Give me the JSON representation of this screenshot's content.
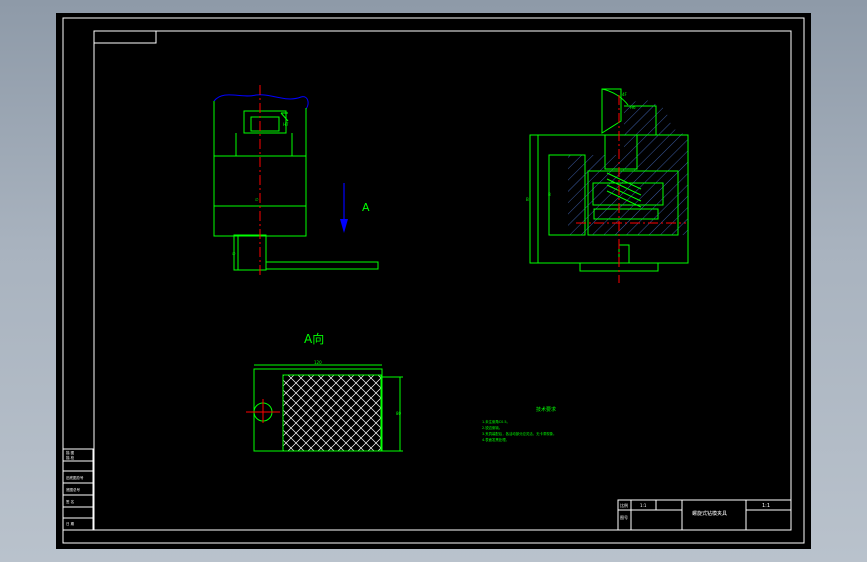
{
  "drawing": {
    "view_label": "A",
    "view_caption": "A向",
    "notes_title": "技术要求",
    "notes": [
      "1.未注倒角C0.5。",
      "2.锐边倒钝。",
      "3.夹具装配后，各活动部分应灵活，无卡滞现象。",
      "4.表面发黑处理。"
    ],
    "title_block": {
      "drawing_title": "螺旋式钻模夹具",
      "scale": "1:1",
      "cells": [
        "比例",
        "1:1",
        "图号"
      ]
    },
    "side_table": [
      "描 图",
      "描 校",
      "旧底图总号",
      "底图总号",
      "签 名",
      "日 期"
    ],
    "colors": {
      "outline": "#ffffff",
      "part_line": "#00ff00",
      "center_line": "#ff0000",
      "hidden_line": "#0000ff",
      "hatch": "#3a5aa0",
      "text": "#00ff00"
    }
  }
}
